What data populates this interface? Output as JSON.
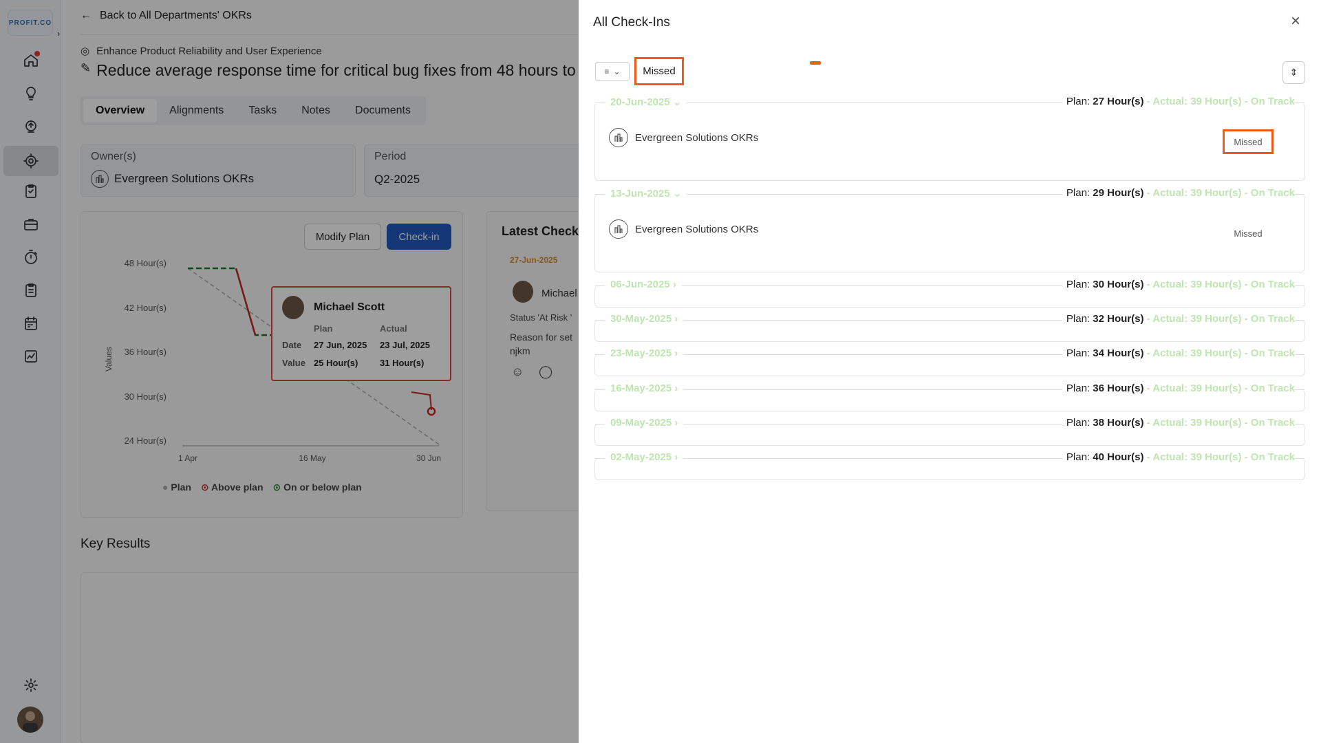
{
  "sidebar": {
    "logo": "PROFIT.CO",
    "nav": [
      "home-icon",
      "bulb-icon",
      "rocket-icon",
      "target-icon",
      "task-icon",
      "briefcase-icon",
      "stopwatch-icon",
      "clipboard-icon",
      "calendar-icon",
      "chart-icon"
    ],
    "settings": "gear-icon"
  },
  "main": {
    "back": "Back to All Departments' OKRs",
    "objective": "Enhance Product Reliability and User Experience",
    "key_result": "Reduce average response time for critical bug fixes from 48 hours to",
    "tabs": [
      "Overview",
      "Alignments",
      "Tasks",
      "Notes",
      "Documents"
    ],
    "owner_label": "Owner(s)",
    "owner": "Evergreen Solutions OKRs",
    "period_label": "Period",
    "period": "Q2-2025",
    "modify_plan": "Modify Plan",
    "check_in": "Check-in",
    "latest_checkin": "Latest Check-",
    "latest": {
      "date": "27-Jun-2025",
      "user": "Michael",
      "status": "Status 'At Risk '",
      "reason": "Reason for set",
      "note": "njkm"
    },
    "key_results": "Key Results"
  },
  "chart": {
    "chart_data": {
      "type": "line",
      "ylabel": "Values",
      "yticks": [
        "48 Hour(s)",
        "42 Hour(s)",
        "36 Hour(s)",
        "30 Hour(s)",
        "24 Hour(s)"
      ],
      "xticks": [
        "1 Apr",
        "16 May",
        "30 Jun"
      ],
      "legend": [
        "Plan",
        "Above plan",
        "On or below plan"
      ]
    },
    "tooltip": {
      "name": "Michael Scott",
      "col_plan": "Plan",
      "col_actual": "Actual",
      "row_date": "Date",
      "row_value": "Value",
      "plan_date": "27 Jun, 2025",
      "actual_date": "23 Jul, 2025",
      "plan_value": "25 Hour(s)",
      "actual_value": "31 Hour(s)"
    }
  },
  "panel": {
    "title": "All Check-Ins",
    "filter_value": "Missed",
    "colors": {
      "accent": "#f05a1a",
      "on_track": "#bfe5b0"
    },
    "groups": [
      {
        "date": "20-Jun-2025",
        "plan": "27 Hour(s)",
        "actual": "39 Hour(s)",
        "status": "On Track",
        "expanded": true,
        "org": "Evergreen Solutions OKRs",
        "row_status": "Missed"
      },
      {
        "date": "13-Jun-2025",
        "plan": "29 Hour(s)",
        "actual": "39 Hour(s)",
        "status": "On Track",
        "expanded": true,
        "org": "Evergreen Solutions OKRs",
        "row_status": "Missed"
      },
      {
        "date": "06-Jun-2025",
        "plan": "30 Hour(s)",
        "actual": "39 Hour(s)",
        "status": "On Track"
      },
      {
        "date": "30-May-2025",
        "plan": "32 Hour(s)",
        "actual": "39 Hour(s)",
        "status": "On Track"
      },
      {
        "date": "23-May-2025",
        "plan": "34 Hour(s)",
        "actual": "39 Hour(s)",
        "status": "On Track"
      },
      {
        "date": "16-May-2025",
        "plan": "36 Hour(s)",
        "actual": "39 Hour(s)",
        "status": "On Track"
      },
      {
        "date": "09-May-2025",
        "plan": "38 Hour(s)",
        "actual": "39 Hour(s)",
        "status": "On Track"
      },
      {
        "date": "02-May-2025",
        "plan": "40 Hour(s)",
        "actual": "39 Hour(s)",
        "status": "On Track"
      }
    ],
    "plan_label": "Plan:",
    "actual_label": "Actual:"
  }
}
